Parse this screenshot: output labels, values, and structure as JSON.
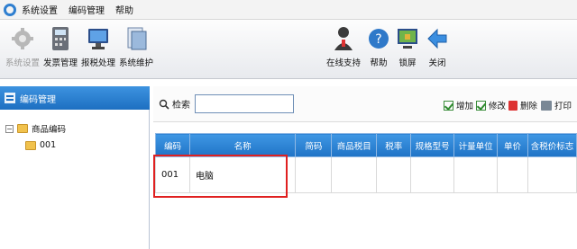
{
  "menubar": {
    "items": [
      "系统设置",
      "编码管理",
      "帮助"
    ]
  },
  "toolbar": {
    "left": [
      {
        "label": "系统设置",
        "icon": "gear-icon"
      },
      {
        "label": "发票管理",
        "icon": "calculator-icon"
      },
      {
        "label": "报税处理",
        "icon": "monitor-icon"
      },
      {
        "label": "系统维护",
        "icon": "document-icon"
      }
    ],
    "right": [
      {
        "label": "在线支持",
        "icon": "support-person-icon"
      },
      {
        "label": "帮助",
        "icon": "help-icon"
      },
      {
        "label": "锁屏",
        "icon": "lock-screen-icon"
      },
      {
        "label": "关闭",
        "icon": "back-arrow-icon"
      }
    ]
  },
  "sidebar": {
    "title": "编码管理",
    "tree": {
      "root": "商品编码",
      "child": "001"
    }
  },
  "search": {
    "label": "检索",
    "value": ""
  },
  "actions": {
    "add": "增加",
    "edit": "修改",
    "delete": "删除",
    "print": "打印"
  },
  "table": {
    "columns": [
      "编码",
      "名称",
      "简码",
      "商品税目",
      "税率",
      "规格型号",
      "计量单位",
      "单价",
      "含税价标志"
    ],
    "rows": [
      {
        "code": "001",
        "name": "电脑"
      }
    ]
  },
  "colors": {
    "header_blue": "#2a82d6",
    "highlight_red": "#e02020"
  }
}
